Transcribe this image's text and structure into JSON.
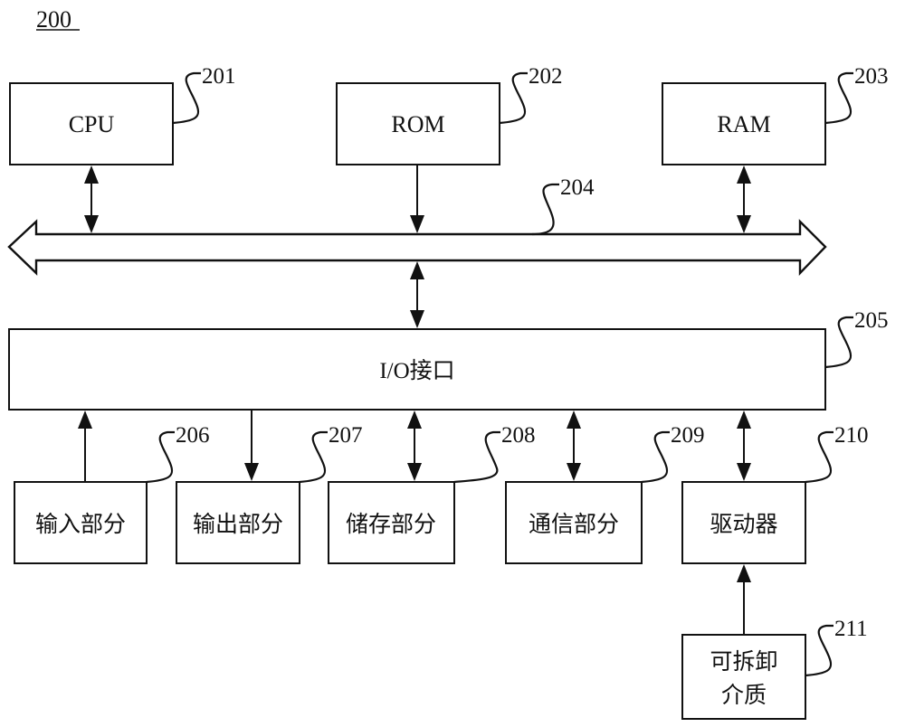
{
  "figure": {
    "number": "200",
    "stroke_color": "#111111",
    "background": "#ffffff"
  },
  "components": {
    "cpu": {
      "label": "CPU",
      "ref": "201"
    },
    "rom": {
      "label": "ROM",
      "ref": "202"
    },
    "ram": {
      "label": "RAM",
      "ref": "203"
    },
    "bus": {
      "label": "",
      "ref": "204"
    },
    "io": {
      "label": "I/O接口",
      "ref": "205"
    },
    "input": {
      "label": "输入部分",
      "ref": "206"
    },
    "output": {
      "label": "输出部分",
      "ref": "207"
    },
    "storage": {
      "label": "储存部分",
      "ref": "208"
    },
    "comm": {
      "label": "通信部分",
      "ref": "209"
    },
    "driver": {
      "label": "驱动器",
      "ref": "210"
    },
    "media": {
      "label_line1": "可拆卸",
      "label_line2": "介质",
      "ref": "211"
    }
  },
  "connections": [
    {
      "from": "cpu",
      "to": "bus",
      "direction": "bidirectional"
    },
    {
      "from": "rom",
      "to": "bus",
      "direction": "one-way"
    },
    {
      "from": "ram",
      "to": "bus",
      "direction": "bidirectional"
    },
    {
      "from": "bus",
      "to": "io",
      "direction": "bidirectional"
    },
    {
      "from": "input",
      "to": "io",
      "direction": "one-way"
    },
    {
      "from": "io",
      "to": "output",
      "direction": "one-way"
    },
    {
      "from": "io",
      "to": "storage",
      "direction": "bidirectional"
    },
    {
      "from": "io",
      "to": "comm",
      "direction": "bidirectional"
    },
    {
      "from": "io",
      "to": "driver",
      "direction": "bidirectional"
    },
    {
      "from": "media",
      "to": "driver",
      "direction": "one-way"
    }
  ]
}
